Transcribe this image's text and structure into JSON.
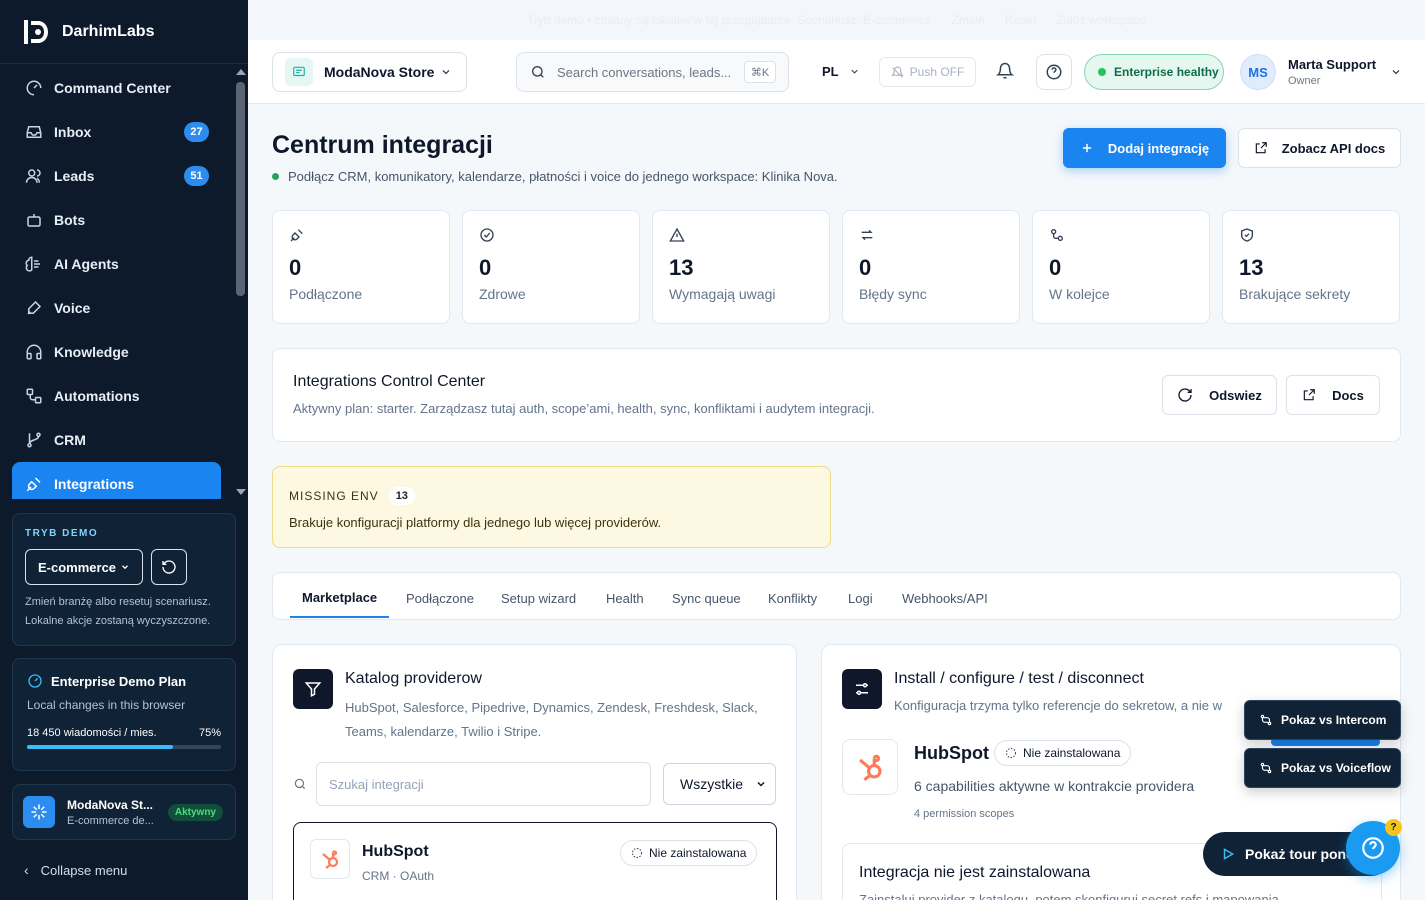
{
  "app": {
    "name": "DarhimLabs"
  },
  "sidebar": {
    "items": [
      {
        "label": "Command Center",
        "icon": "gauge-icon"
      },
      {
        "label": "Inbox",
        "icon": "inbox-icon",
        "badge": "27"
      },
      {
        "label": "Leads",
        "icon": "users-icon",
        "badge": "51"
      },
      {
        "label": "Bots",
        "icon": "bot-icon"
      },
      {
        "label": "AI Agents",
        "icon": "brain-icon"
      },
      {
        "label": "Voice",
        "icon": "mic-icon"
      },
      {
        "label": "Knowledge",
        "icon": "headphones-icon"
      },
      {
        "label": "Automations",
        "icon": "workflow-icon"
      },
      {
        "label": "CRM",
        "icon": "git-branch-icon"
      },
      {
        "label": "Integrations",
        "icon": "plug-icon",
        "active": true
      }
    ],
    "demo": {
      "title": "TRYB DEMO",
      "industry": "E-commerce",
      "description": "Zmień branżę albo resetuj scenariusz. Lokalne akcje zostaną wyczyszczone."
    },
    "plan": {
      "name": "Enterprise Demo Plan",
      "subtitle": "Local changes in this browser",
      "usage": "18 450 wiadomości / mies.",
      "percent_label": "75%",
      "percent": 0.75
    },
    "workspace": {
      "name": "ModaNova St...",
      "sub": "E-commerce de...",
      "status": "Aktywny"
    },
    "collapse": "Collapse menu"
  },
  "banner": {
    "text": "Tryb demo • zmiany są lokalne w tej przeglądarce. Scenariusz: E-commerce",
    "change": "Zmień",
    "reset": "Reset",
    "create": "Załóż workspace"
  },
  "header": {
    "store": "ModaNova Store",
    "search_placeholder": "Search conversations, leads...",
    "shortcut": "⌘K",
    "lang": "PL",
    "push": "Push OFF",
    "health": "Enterprise healthy",
    "user": {
      "initials": "MS",
      "name": "Marta Support",
      "role": "Owner"
    }
  },
  "page": {
    "title": "Centrum integracji",
    "subtitle": "Podłącz CRM, komunikatory, kalendarze, płatności i voice do jednego workspace: Klinika Nova.",
    "add_button": "Dodaj integrację",
    "api_button": "Zobacz API docs"
  },
  "stats": [
    {
      "value": "0",
      "label": "Podłączone",
      "icon": "plug-icon"
    },
    {
      "value": "0",
      "label": "Zdrowe",
      "icon": "check-circle-icon"
    },
    {
      "value": "13",
      "label": "Wymagają uwagi",
      "icon": "alert-triangle-icon"
    },
    {
      "value": "0",
      "label": "Błędy sync",
      "icon": "arrows-icon"
    },
    {
      "value": "0",
      "label": "W kolejce",
      "icon": "queue-icon"
    },
    {
      "value": "13",
      "label": "Brakujące sekrety",
      "icon": "shield-icon"
    }
  ],
  "control": {
    "title": "Integrations Control Center",
    "desc": "Aktywny plan: starter. Zarządzasz tutaj auth, scope’ami, health, sync, konfliktami i audytem integracji.",
    "refresh": "Odswiez",
    "docs": "Docs"
  },
  "missing": {
    "title": "MISSING ENV",
    "count": "13",
    "desc": "Brakuje konfiguracji platformy dla jednego lub więcej providerów."
  },
  "tabs": [
    "Marketplace",
    "Podłączone",
    "Setup wizard",
    "Health",
    "Sync queue",
    "Konflikty",
    "Logi",
    "Webhooks/API"
  ],
  "catalog": {
    "title": "Katalog providerow",
    "desc": "HubSpot, Salesforce, Pipedrive, Dynamics, Zendesk, Freshdesk, Slack, Teams, kalendarze, Twilio i Stripe.",
    "search_placeholder": "Szukaj integracji",
    "filter": "Wszystkie",
    "card": {
      "name": "HubSpot",
      "meta": "CRM · OAuth",
      "status": "Nie zainstalowana"
    }
  },
  "install": {
    "title": "Install / configure / test / disconnect",
    "desc": "Konfiguracja trzyma tylko referencje do sekretow, a nie w",
    "provider": "HubSpot",
    "status": "Nie zainstalowana",
    "capabilities": "6 capabilities aktywne w kontrakcie providera",
    "scopes": "4 permission scopes",
    "notice_title": "Integracja nie jest zainstalowana",
    "notice_desc": "Zainstaluj provider z katalogu, potem skonfiguruj secret refs i mapowania."
  },
  "floating": {
    "intercom": "Pokaz vs Intercom",
    "voiceflow": "Pokaz vs Voiceflow",
    "tour": "Pokaż tour ponownie",
    "help_badge": "?"
  },
  "colors": {
    "accent": "#1a84f0",
    "sidebar": "#0c1a2b",
    "hubspot": "#ff7a59"
  }
}
